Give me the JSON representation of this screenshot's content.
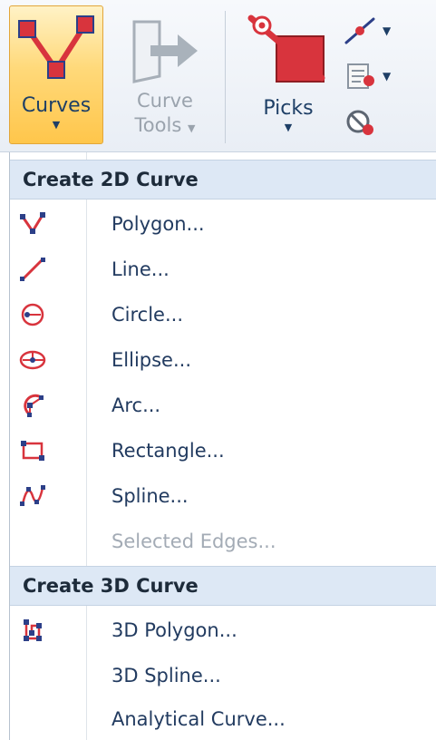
{
  "ribbon": {
    "curves_label": "Curves",
    "curve_tools_line1": "Curve",
    "curve_tools_line2": "Tools",
    "picks_label": "Picks",
    "dropdown_glyph": "▼"
  },
  "menu": {
    "section_2d": "Create 2D Curve",
    "items_2d": [
      {
        "label": "Polygon...",
        "icon": "polygon-icon"
      },
      {
        "label": "Line...",
        "icon": "line-icon"
      },
      {
        "label": "Circle...",
        "icon": "circle-icon"
      },
      {
        "label": "Ellipse...",
        "icon": "ellipse-icon"
      },
      {
        "label": "Arc...",
        "icon": "arc-icon"
      },
      {
        "label": "Rectangle...",
        "icon": "rectangle-icon"
      },
      {
        "label": "Spline...",
        "icon": "spline-icon"
      },
      {
        "label": "Selected Edges...",
        "icon": "",
        "disabled": true
      }
    ],
    "section_3d": "Create 3D Curve",
    "items_3d": [
      {
        "label": "3D Polygon...",
        "icon": "polygon-3d-icon"
      },
      {
        "label": "3D Spline...",
        "icon": ""
      },
      {
        "label": "Analytical Curve...",
        "icon": ""
      }
    ]
  },
  "colors": {
    "accent_red": "#d8343d",
    "node_navy": "#2c3f88",
    "header_bg": "#dde8f5",
    "active_button": "#ffd97a"
  }
}
